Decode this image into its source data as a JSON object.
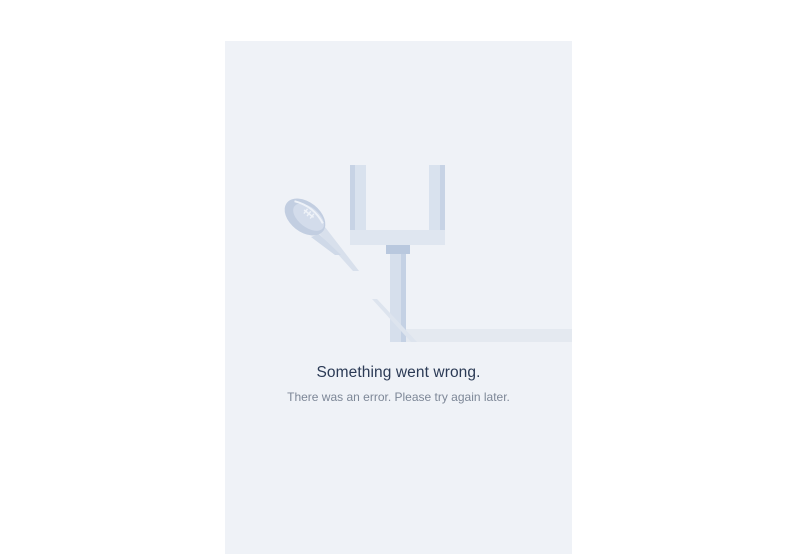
{
  "error": {
    "title": "Something went wrong.",
    "message": "There was an error. Please try again later."
  },
  "illustration": {
    "subject": "football-goalpost-and-ball",
    "colors": {
      "panel_bg": "#eff2f7",
      "post_light": "#dde5ef",
      "post_mid": "#c9d5e6",
      "post_dark": "#b6c5dc",
      "ground": "#e4e9f0",
      "ball": "#c3cfe0"
    }
  }
}
